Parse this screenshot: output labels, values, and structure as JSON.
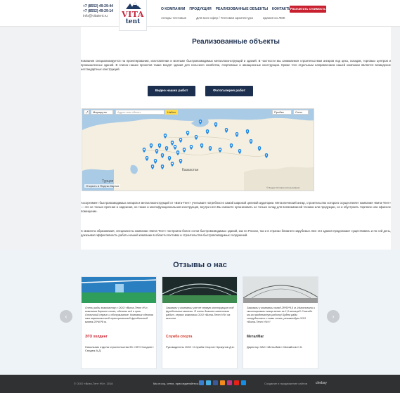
{
  "header": {
    "phones": [
      "+7 (8552) 49-29-44",
      "+7 (8552) 49-29-14"
    ],
    "email": "info@vitatent.ru",
    "logo_brand": "VITA",
    "logo_brand2": "tent",
    "nav": [
      "О КОМПАНИИ",
      "ПРОДУКЦИЯ",
      "РЕАЛИЗОВАННЫЕ ОБЪЕКТЫ",
      "КОНТАКТЫ"
    ],
    "cta_label": "Рассчитать стоимость",
    "subnav": [
      "Ангары тентовые",
      "Для всех сфер / Тентовая архитектура",
      "Здания из ЛМК"
    ]
  },
  "main": {
    "title": "Реализованные объекты",
    "intro": "Компания специализируется на проектировании, изготовлении и монтаже быстровозводимых металлоконструкций и зданий. В частности мы занимаемся строительством ангаров под цеха, складов, торговых центров и промышленных зданий. В список наших проектов также входят здания для сельского хозяйства, спортивные и авиационные конструкции. Кроме того отдельным направлением нашей компании является возведение нестандартных конструкций.",
    "video_btn": "Видео наших работ",
    "photo_btn": "Фотогалерея работ",
    "map": {
      "routes_label": "Маршруты",
      "search_placeholder": "Адрес или объект",
      "find_label": "Найти",
      "traffic_label": "Пробки",
      "layers_label": "Слои",
      "label_kazakhstan": "Казахстан",
      "label_turkey": "Турция",
      "footer_link": "Открыть в Яндекс.Картах",
      "copyright": "© Яндекс Условия использования"
    },
    "desc1": "Ассортимент быстровозводимых ангаров и металлоконструкций от «Вита-Тент» учитывает потребности самой широкой целевой аудитории. Металлический ангар, строительство которого осуществляет компания «Вита-Тент» — это не только прочная и надежная, но также и многофункциональная конструкция, внутри него Вы сможете организовать не только склад для всевозможной техники или продукции, но и обустроить торговое или офисное помещение.",
    "desc2": "С момента образования, специалисты компании «Вита-Тент» построили более сотни быстровозводимых зданий, как по России, так и в странах ближнего зарубежья. Все эти здания продолжают существовать и по сей день, доказывая эффективность работы нашей компании в области поставок и строительства быстровозводимых сооружений."
  },
  "reviews": {
    "title": "Отзывы о нас",
    "items": [
      {
        "quote": "Очень рады знакомству с ООО «Вита-Тент НЧ», компания держит слово, сделано всё в срок. Отличный сервис и обслуживание. Компания сделала нам первоклассный тренировочный футбольный манеж 20*40*8 м.",
        "brand": "ЭГО холдинг",
        "sig": "Начальник отдела строительства ЗК «ЭГО Холдинг» Сердюк А.Д."
      },
      {
        "quote": "Заказали у компании уже не первую конструкцию под футбольные манежи. Я очень доволен качеством работ, сервис компании ООО «Вита-Тент НЧ» на высоте.",
        "brand": "Служба спорта",
        "sig": "Руководитель ООО «Служба Спорта» Крикунов Д.А."
      },
      {
        "quote": "Заказали у компании склад 28*50*9,5 м. Изготовили и смонтировали ангар всего за 1,5 месяца!!! Спасибо им за проделанную работу! Будем рады сотрудничать с вами снова, рекомендую ООО «Вита-Тент НЧ»!!",
        "brand": "МеталМаг",
        "sig": "Директор ЗАО «МеталМаг» Михайлов С.К."
      }
    ]
  },
  "footer": {
    "copyright": "© ООО «Вита-Тент НЧ», 2018",
    "social_text": "Мы в соц. сетях, присоединяйтесь:",
    "made": "Создание и продвижение сайтов",
    "chebsy": "chebsy"
  }
}
